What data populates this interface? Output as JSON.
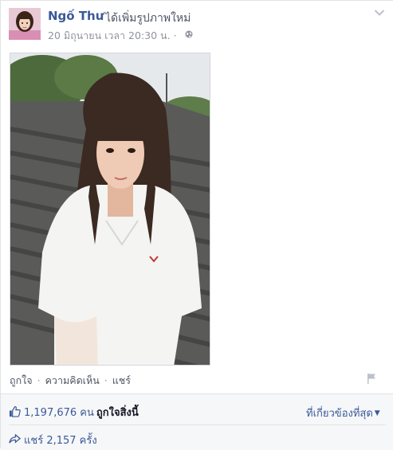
{
  "post": {
    "author": "Ngố Thư",
    "action_text": "ได้เพิ่มรูปภาพใหม่",
    "timestamp": "20 มิถุนายน เวลา 20:30 น.",
    "privacy_icon": "globe-icon",
    "options_icon": "chevron-down-icon"
  },
  "actions": {
    "like": "ถูกใจ",
    "comment": "ความคิดเห็น",
    "share": "แชร์",
    "separator": "·"
  },
  "ufi": {
    "like_count": "1,197,676 คน",
    "like_suffix": "ถูกใจสิ่งนี้",
    "relevant": "ที่เกี่ยวข้องที่สุด",
    "shares": "แชร์ 2,157 ครั้ง"
  },
  "colors": {
    "link": "#3b5998",
    "meta": "#90949c",
    "ufi_bg": "#f6f7f9"
  }
}
